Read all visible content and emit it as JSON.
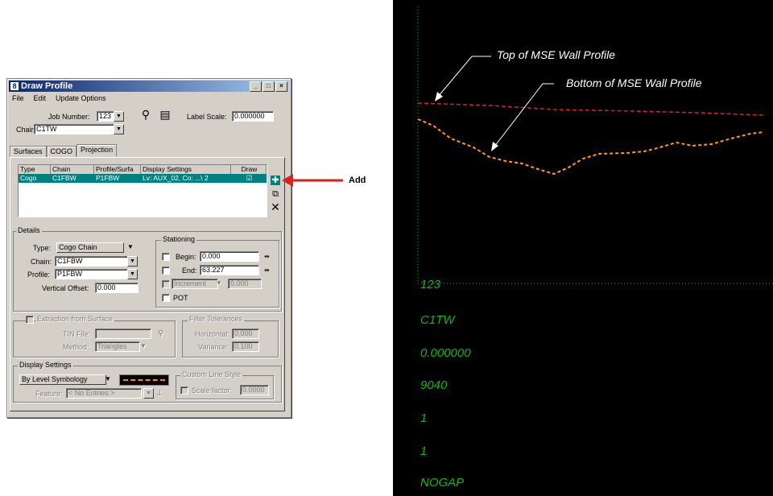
{
  "window": {
    "title": "Draw Profile",
    "controls": [
      "_",
      "□",
      "×"
    ],
    "menu": [
      "File",
      "Edit",
      "Update Options"
    ]
  },
  "header": {
    "job_number_label": "Job Number:",
    "job_number_value": "123",
    "chain_label": "Chain:",
    "chain_value": "C1TW",
    "label_scale_label": "Label Scale:",
    "label_scale_value": "0.000000"
  },
  "tabs": [
    "Surfaces",
    "COGO",
    "Projection"
  ],
  "table": {
    "columns": [
      "Type",
      "Chain",
      "Profile/Surfa",
      "Display Settings",
      "Draw"
    ],
    "rows": [
      {
        "type": "Cogo",
        "chain": "C1FBW",
        "profile": "P1FBW",
        "display": "Lv: AUX_02, Co: ...\\ 2",
        "draw": "☑"
      }
    ]
  },
  "details": {
    "title": "Details",
    "type_label": "Type:",
    "type_value": "Cogo Chain",
    "chain_label": "Chain:",
    "chain_value": "C1FBW",
    "profile_label": "Profile:",
    "profile_value": "P1FBW",
    "offset_label": "Vertical Offset:",
    "offset_value": "0.000"
  },
  "stationing": {
    "title": "Stationing",
    "begin_label": "Begin:",
    "begin_value": "0.000",
    "end_label": "End:",
    "end_value": "63.227",
    "increment_label": "Increment",
    "increment_value": "0.000",
    "pot_label": "POT"
  },
  "extraction": {
    "title": "Extraction from Surface",
    "tin_label": "TIN File:",
    "method_label": "Method:",
    "method_value": "Triangles"
  },
  "filter": {
    "title": "Filter Tolerances",
    "horizontal_label": "Horizontal:",
    "horizontal_value": "0.000",
    "variance_label": "Variance:",
    "variance_value": "0.100"
  },
  "display_settings": {
    "title": "Display Settings",
    "symbology_value": "By Level Symbology",
    "feature_label": "Feature:",
    "feature_value": "< No Entries >"
  },
  "custom_line_style": {
    "title": "Custom Line Style",
    "scale_label": "Scale factor:",
    "scale_value": "0.0000"
  },
  "annotation": {
    "add_label": "Add"
  },
  "profile_view": {
    "top_label": "Top of MSE Wall Profile",
    "bottom_label": "Bottom of MSE Wall Profile",
    "values": [
      "123",
      "C1TW",
      "0.000000",
      "9040",
      "1",
      "1",
      "NOGAP"
    ]
  },
  "colors": {
    "titlebar": "#0a246a",
    "selection": "#008080",
    "red_line": "#e0202a",
    "orange_line": "#ff9a1a",
    "green_text": "#19b419"
  }
}
